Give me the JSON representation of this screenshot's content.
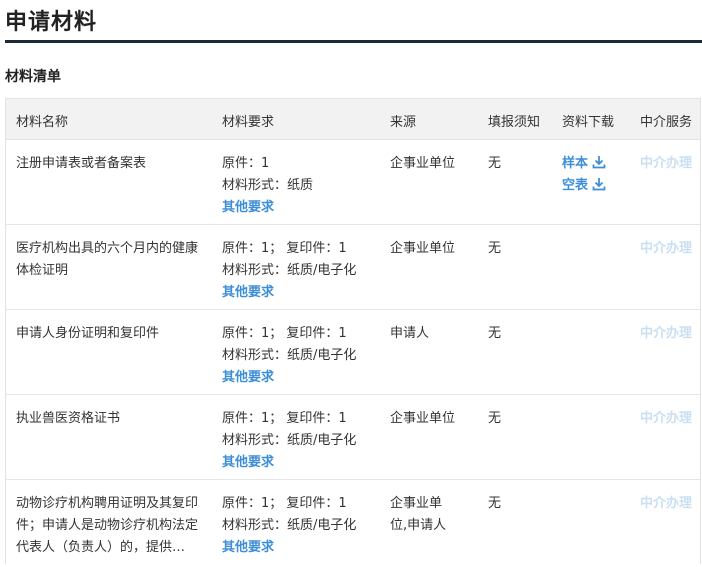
{
  "page": {
    "title": "申请材料",
    "section_title": "材料清单"
  },
  "table": {
    "headers": {
      "name": "材料名称",
      "requirement": "材料要求",
      "source": "来源",
      "fill_notice": "填报须知",
      "download": "资料下载",
      "service": "中介服务"
    },
    "rows": [
      {
        "name": "注册申请表或者备案表",
        "req_line1": "原件：1",
        "req_line2": "材料形式：纸质",
        "req_other": "其他要求",
        "source": "企事业单位",
        "fill_notice": "无",
        "download_sample": "样本",
        "download_blank": "空表",
        "service": "中介办理"
      },
      {
        "name": "医疗机构出具的六个月内的健康体检证明",
        "req_line1": "原件：1；  复印件：1",
        "req_line2": "材料形式：纸质/电子化",
        "req_other": "其他要求",
        "source": "企事业单位",
        "fill_notice": "无",
        "service": "中介办理"
      },
      {
        "name": "申请人身份证明和复印件",
        "req_line1": "原件：1；  复印件：1",
        "req_line2": "材料形式：纸质/电子化",
        "req_other": "其他要求",
        "source": "申请人",
        "fill_notice": "无",
        "service": "中介办理"
      },
      {
        "name": "执业兽医资格证书",
        "req_line1": "原件：1；  复印件：1",
        "req_line2": "材料形式：纸质/电子化",
        "req_other": "其他要求",
        "source": "企事业单位",
        "fill_notice": "无",
        "service": "中介办理"
      },
      {
        "name": "动物诊疗机构聘用证明及其复印件；申请人是动物诊疗机构法定代表人（负责人）的，提供…",
        "req_line1": "原件：1；  复印件：1",
        "req_line2": "材料形式：纸质/电子化",
        "req_other": "其他要求",
        "source_line1": "企事业单",
        "source_line2": "位,申请人",
        "fill_notice": "无",
        "service": "中介办理"
      }
    ]
  },
  "colors": {
    "link": "#3d8ed8",
    "service_disabled": "#c9dff2",
    "header_bg": "#f2f2f2",
    "title_rule": "#1b2a38"
  },
  "icons": {
    "download": "download-icon"
  }
}
